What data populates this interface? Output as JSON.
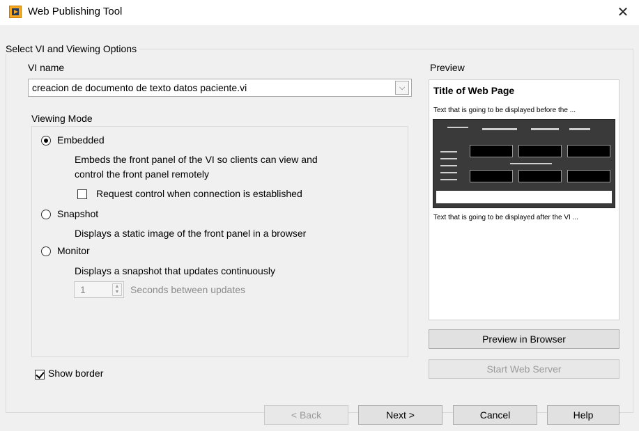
{
  "window": {
    "title": "Web Publishing Tool",
    "close_glyph": "✕",
    "app_icon": "labview-web-icon"
  },
  "group": {
    "label": "Select VI and Viewing Options"
  },
  "vi_name": {
    "label": "VI name",
    "value": "creacion de documento de texto datos paciente.vi",
    "dropdown_glyph": "⌵"
  },
  "viewing_mode": {
    "label": "Viewing Mode",
    "embedded": {
      "label": "Embedded",
      "selected": true,
      "desc1": "Embeds the front panel of the VI so clients can view and",
      "desc2": "control the front panel remotely",
      "request_control_label": "Request control when connection is established",
      "request_control_checked": false
    },
    "snapshot": {
      "label": "Snapshot",
      "selected": false,
      "desc": "Displays a static image of the front panel in a browser"
    },
    "monitor": {
      "label": "Monitor",
      "selected": false,
      "desc": "Displays a snapshot that updates continuously",
      "seconds_value": "1",
      "seconds_label": "Seconds between updates"
    }
  },
  "show_border": {
    "label": "Show border",
    "checked": true
  },
  "preview": {
    "label": "Preview",
    "page_title": "Title of Web Page",
    "text_before": "Text that is going to be displayed before the ...",
    "text_after": "Text that is going to be displayed after the VI ...",
    "preview_button": "Preview in Browser",
    "start_server_button": "Start Web Server"
  },
  "footer": {
    "back": "< Back",
    "next": "Next >",
    "cancel": "Cancel",
    "help": "Help"
  }
}
